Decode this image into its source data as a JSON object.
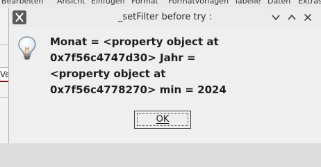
{
  "background_app": {
    "menu_items": [
      "Bearbeiten",
      "Ansicht",
      "Einfügen",
      "Format",
      "Formatvorlagen",
      "Tabelle",
      "Daten",
      "Extras"
    ],
    "field_fragment": "Ve"
  },
  "dialog": {
    "title": "_setFilter before try :",
    "icon": "info-lightbulb-icon",
    "message": "Monat = <property object at 0x7f56c4747d30> Jahr = <property object at 0x7f56c4778270> min = 2024",
    "ok_label": "OK",
    "window_controls": {
      "minimize": "chevron-down-icon",
      "maximize": "chevron-up-icon",
      "close": "close-icon"
    }
  }
}
